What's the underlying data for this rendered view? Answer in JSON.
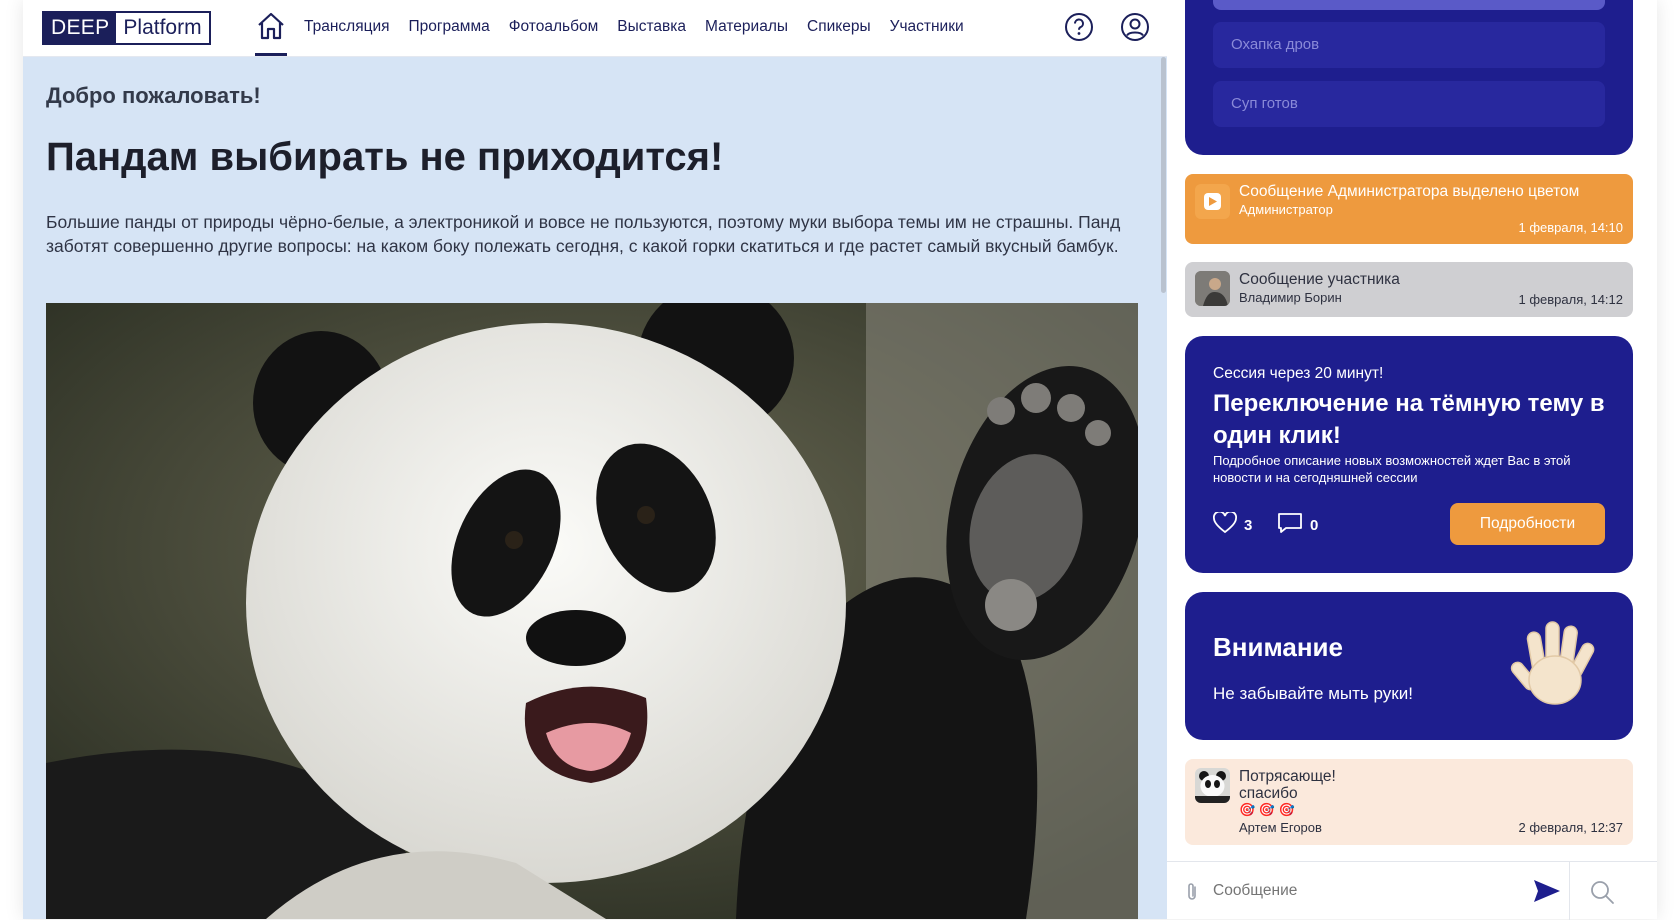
{
  "logo": {
    "part1": "DEEP",
    "part2": "Platform"
  },
  "nav": {
    "items": [
      "Трансляция",
      "Программа",
      "Фотоальбом",
      "Выставка",
      "Материалы",
      "Спикеры",
      "Участники"
    ],
    "home_icon": "home-icon",
    "help_icon": "help-icon",
    "profile_icon": "user-icon"
  },
  "main": {
    "welcome": "Добро пожаловать!",
    "headline": "Пандам выбирать не приходится!",
    "body": "Большие панды от природы чёрно-белые, а электроникой и вовсе не пользуются, поэтому муки выбора темы им не страшны. Панд заботят совершенно другие вопросы: на каком боку полежать сегодня, с какой горки скатиться и где растет самый вкусный бамбук."
  },
  "sidebar": {
    "poll": {
      "options": [
        "Охапка дров",
        "Суп готов"
      ]
    },
    "messages": [
      {
        "text": "Сообщение Администратора выделено цветом",
        "author": "Администратор",
        "date": "1 февраля, 14:10"
      },
      {
        "text": "Сообщение участника",
        "author": "Владимир Борин",
        "date": "1 февраля, 14:12"
      },
      {
        "text": "Потрясающе!",
        "text2": "спасибо",
        "emoji": "🎯 🎯 🎯",
        "author": "Артем Егоров",
        "date": "2 февраля, 12:37"
      }
    ],
    "session": {
      "kicker": "Сессия через 20 минут!",
      "title": "Переключение на тёмную тему в один клик!",
      "desc": "Подробное описание новых возможностей ждет Вас в этой новости и на сегодняшней сессии",
      "likes": "3",
      "comments": "0",
      "button": "Подробности"
    },
    "attention": {
      "title": "Внимание",
      "text": "Не забывайте мыть руки!"
    },
    "composer": {
      "placeholder": "Сообщение"
    }
  },
  "colors": {
    "navy": "#1b1f5a",
    "panel": "#1e1e8e",
    "orange": "#ee9a3e",
    "content_bg": "#d6e4f5"
  }
}
